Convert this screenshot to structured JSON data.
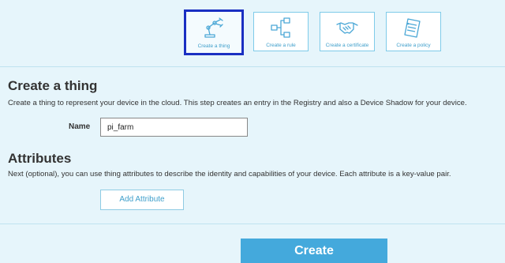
{
  "tiles": [
    {
      "label": "Create a thing",
      "icon": "robot-arm-icon",
      "active": true
    },
    {
      "label": "Create a rule",
      "icon": "flowchart-icon",
      "active": false
    },
    {
      "label": "Create a certificate",
      "icon": "handshake-icon",
      "active": false
    },
    {
      "label": "Create a policy",
      "icon": "policy-document-icon",
      "active": false
    }
  ],
  "create_thing": {
    "title": "Create a thing",
    "description": "Create a thing to represent your device in the cloud. This step creates an entry in the Registry and also a Device Shadow for your device.",
    "name_label": "Name",
    "name_value": "pi_farm"
  },
  "attributes": {
    "title": "Attributes",
    "description": "Next (optional), you can use thing attributes to describe the identity and capabilities of your device. Each attribute is a key-value pair.",
    "add_button": "Add Attribute"
  },
  "submit": {
    "label": "Create"
  },
  "colors": {
    "background": "#e6f5fb",
    "accent": "#44a9dc",
    "tile_border": "#7fcbe9",
    "active_border": "#1a2fc2"
  }
}
